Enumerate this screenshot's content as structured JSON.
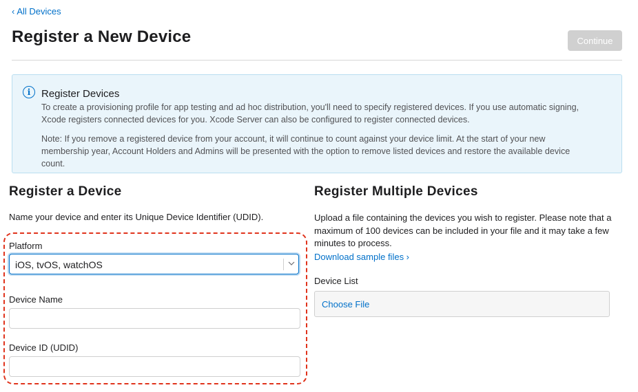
{
  "nav": {
    "back_chevron": "‹",
    "back_label": "All Devices"
  },
  "header": {
    "title": "Register a New Device",
    "continue_label": "Continue"
  },
  "info": {
    "icon": "i",
    "heading": "Register Devices",
    "paragraph1": "To create a provisioning profile for app testing and ad hoc distribution, you'll need to specify registered devices. If you use automatic signing, Xcode registers connected devices for you. Xcode Server can also be configured to register connected devices.",
    "paragraph2": "Note: If you remove a registered device from your account, it will continue to count against your device limit. At the start of your new membership year, Account Holders and Admins will be presented with the option to remove listed devices and restore the available device count."
  },
  "single": {
    "heading": "Register a Device",
    "intro": "Name your device and enter its Unique Device Identifier (UDID).",
    "platform_label": "Platform",
    "platform_value": "iOS, tvOS, watchOS",
    "device_name_label": "Device Name",
    "device_name_value": "",
    "udid_label": "Device ID (UDID)",
    "udid_value": ""
  },
  "multiple": {
    "heading": "Register Multiple Devices",
    "intro": "Upload a file containing the devices you wish to register. Please note that a maximum of 100 devices can be included in your file and it may take a few minutes to process.",
    "download_label": "Download sample files ›",
    "device_list_label": "Device List",
    "choose_file_label": "Choose File"
  },
  "colors": {
    "accent": "#0070c9",
    "highlight": "#e0321b",
    "info_bg": "#eaf5fb",
    "disabled_button": "#d0d0d0"
  }
}
